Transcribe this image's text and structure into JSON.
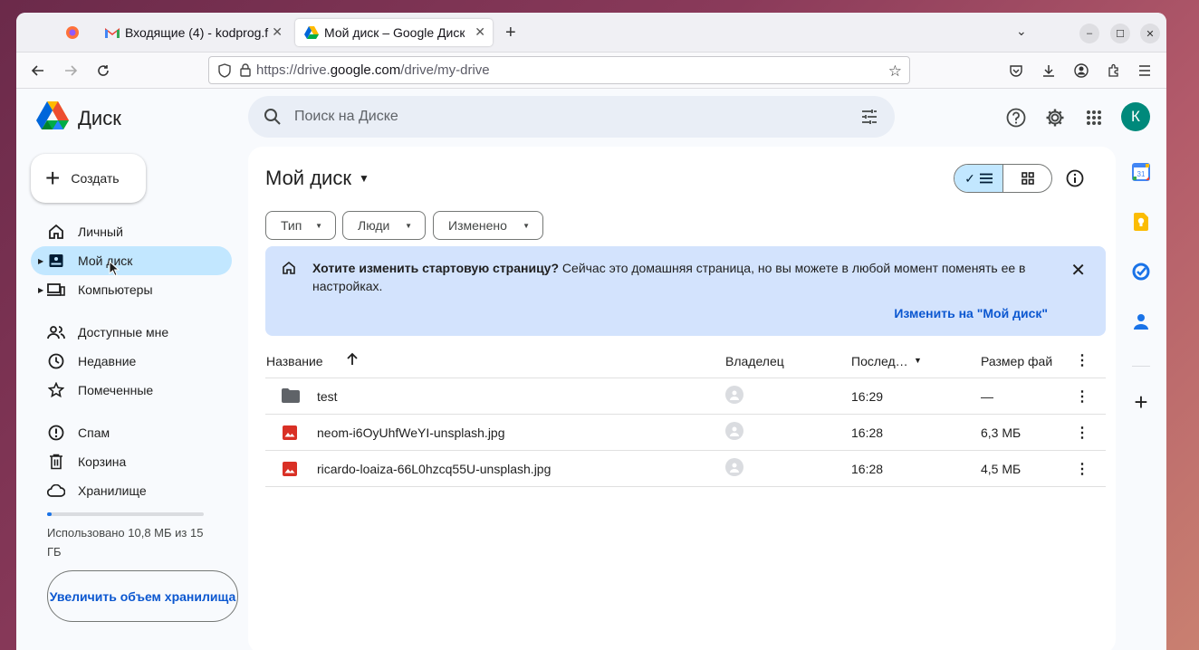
{
  "browser": {
    "tabs": [
      {
        "label": ""
      },
      {
        "label": "Входящие (4) - kodprog.f"
      },
      {
        "label": "Мой диск – Google Диск"
      }
    ],
    "url_prefix": "https://drive.",
    "url_domain": "google.com",
    "url_path": "/drive/my-drive"
  },
  "drive": {
    "logo_text": "Диск",
    "search_placeholder": "Поиск на Диске",
    "avatar_letter": "К",
    "create_label": "Создать",
    "nav": [
      {
        "label": "Личный"
      },
      {
        "label": "Мой диск"
      },
      {
        "label": "Компьютеры"
      },
      {
        "label": "Доступные мне"
      },
      {
        "label": "Недавние"
      },
      {
        "label": "Помеченные"
      },
      {
        "label": "Спам"
      },
      {
        "label": "Корзина"
      },
      {
        "label": "Хранилище"
      }
    ],
    "storage_text": "Использовано 10,8 МБ из 15 ГБ",
    "storage_used_fraction": 0.0007,
    "upgrade_label": "Увеличить объем хранилища"
  },
  "main": {
    "title": "Мой диск",
    "filters": [
      {
        "label": "Тип"
      },
      {
        "label": "Люди"
      },
      {
        "label": "Изменено"
      }
    ],
    "banner": {
      "question": "Хотите изменить стартовую страницу?",
      "text": " Сейчас это домашняя страница, но вы можете в любой момент поменять ее в настройках.",
      "action": "Изменить на \"Мой диск\""
    },
    "columns": {
      "name": "Название",
      "owner": "Владелец",
      "modified": "Послед…",
      "size": "Размер фай"
    },
    "files": [
      {
        "name": "test",
        "type": "folder",
        "owner": "я",
        "modified": "16:29",
        "size": "—"
      },
      {
        "name": "neom-i6OyUhfWeYI-unsplash.jpg",
        "type": "image",
        "owner": "я",
        "modified": "16:28",
        "size": "6,3 МБ"
      },
      {
        "name": "ricardo-loaiza-66L0hzcq55U-unsplash.jpg",
        "type": "image",
        "owner": "я",
        "modified": "16:28",
        "size": "4,5 МБ"
      }
    ]
  }
}
